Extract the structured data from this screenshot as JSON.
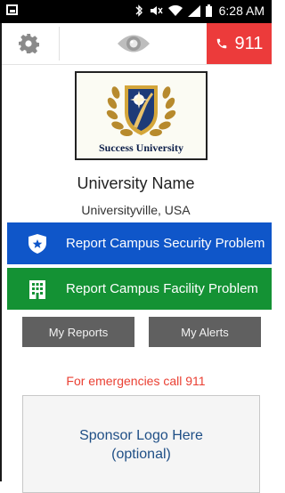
{
  "status_bar": {
    "time": "6:28 AM"
  },
  "toolbar": {
    "settings_icon": "gear-icon",
    "logo_icon": "eye-icon",
    "call_label": "911",
    "call_icon": "phone-icon",
    "call_color": "#ec3b3b"
  },
  "university": {
    "logo_caption": "Success University",
    "name": "University Name",
    "location": "Universityville, USA"
  },
  "actions": {
    "security": {
      "label": "Report Campus Security Problem",
      "icon": "shield-star-icon",
      "color": "#0f56c9"
    },
    "facility": {
      "label": "Report Campus Facility Problem",
      "icon": "building-icon",
      "color": "#149234"
    }
  },
  "buttons": {
    "reports": "My Reports",
    "alerts": "My Alerts"
  },
  "emergency_text": "For emergencies call 911",
  "sponsor": {
    "line1": "Sponsor Logo Here",
    "line2": "(optional)"
  }
}
